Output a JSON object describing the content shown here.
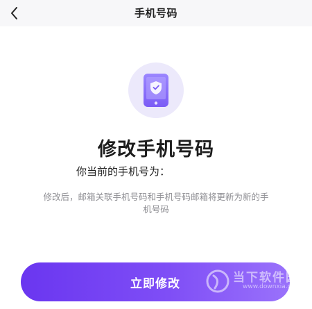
{
  "header": {
    "title": "手机号码",
    "back_icon": "chevron-left-icon"
  },
  "hero": {
    "icon": "shield-phone-icon",
    "accent_color": "#7c4dff",
    "circle_color": "#ece9fb"
  },
  "main": {
    "title": "修改手机号码",
    "current_phone_label": "你当前的手机号为：",
    "current_phone_value": "",
    "description": "修改后，邮箱关联手机号码和手机号码邮箱将更新为新的手机号码"
  },
  "action": {
    "button_label": "立即修改",
    "gradient_start": "#6a36f0",
    "gradient_end": "#9a72fb"
  },
  "watermark": {
    "text": "当下软件园",
    "url": "www.downxia.com"
  }
}
